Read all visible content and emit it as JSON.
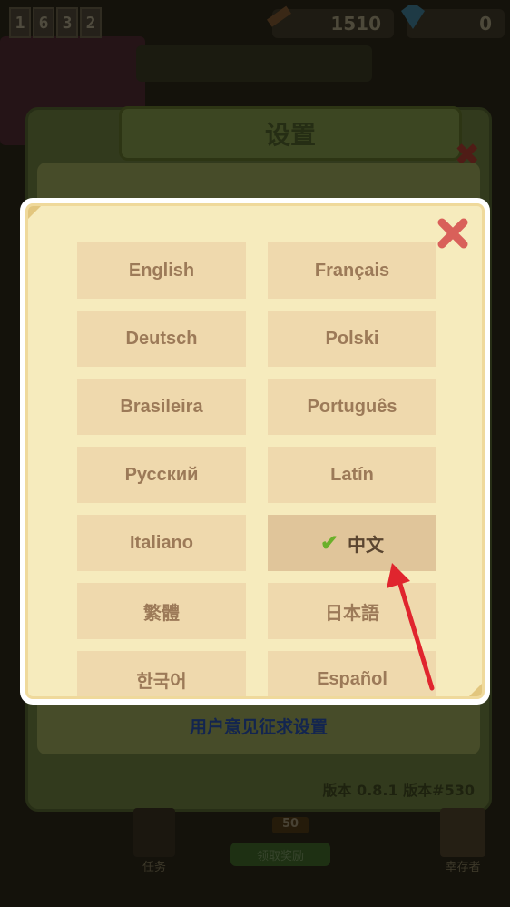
{
  "hud": {
    "counter_digits": [
      "1",
      "6",
      "3",
      "2"
    ],
    "resource_1_value": "1510",
    "resource_2_value": "0",
    "resource_1_icon": "pencil-icon",
    "resource_2_icon": "gem-icon"
  },
  "settings": {
    "title": "设置",
    "feedback_link": "用户意见征求设置",
    "version": "版本 0.8.1 版本#530"
  },
  "bottom_bar": {
    "tasks_label": "任务",
    "reward_count": "50",
    "reward_button": "领取奖励",
    "survivor_label": "幸存者"
  },
  "language_modal": {
    "close_icon": "close-icon",
    "selected_icon": "checkmark-icon",
    "languages": [
      {
        "label": "English"
      },
      {
        "label": "Français"
      },
      {
        "label": "Deutsch"
      },
      {
        "label": "Polski"
      },
      {
        "label": "Brasileira"
      },
      {
        "label": "Português"
      },
      {
        "label": "Русский"
      },
      {
        "label": "Latín"
      },
      {
        "label": "Italiano"
      },
      {
        "label": "中文",
        "selected": true
      },
      {
        "label": "繁體"
      },
      {
        "label": "日本語"
      },
      {
        "label": "한국어"
      },
      {
        "label": "Español"
      }
    ]
  },
  "colors": {
    "modal_bg": "#f6ebbd",
    "button_bg": "#efd9ad",
    "button_text": "#9c7a58",
    "selected_bg": "#e0c59a",
    "close_red": "#d9605a",
    "annotation_arrow": "#e0252e"
  }
}
